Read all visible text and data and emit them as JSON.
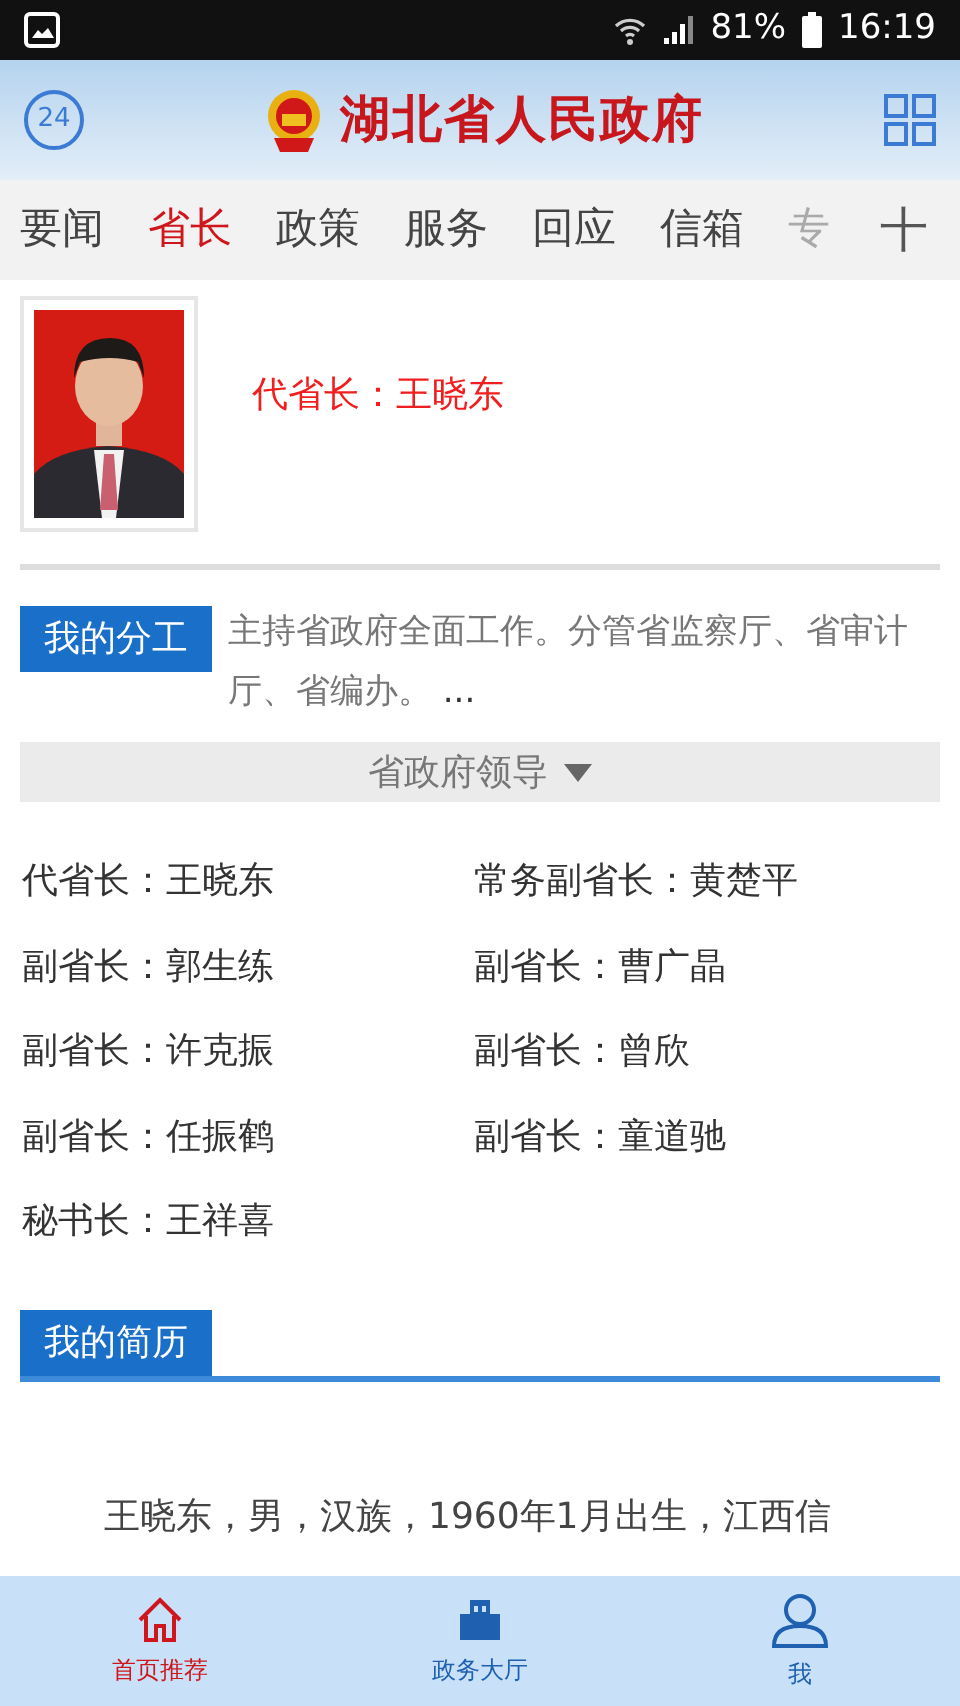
{
  "status_bar": {
    "battery": "81%",
    "time": "16:19"
  },
  "header": {
    "badge": "24",
    "title": "湖北省人民政府"
  },
  "tabs": [
    {
      "label": "要闻",
      "selected": false
    },
    {
      "label": "省长",
      "selected": true
    },
    {
      "label": "政策",
      "selected": false
    },
    {
      "label": "服务",
      "selected": false
    },
    {
      "label": "回应",
      "selected": false
    },
    {
      "label": "信箱",
      "selected": false
    },
    {
      "label": "专",
      "selected": false
    }
  ],
  "add_tab": "十",
  "profile": {
    "title": "代省长：王晓东"
  },
  "division": {
    "label": "我的分工",
    "text": "主持省政府全面工作。分管省监察厅、省审计厅、省编办。",
    "more": "..."
  },
  "leaders": {
    "heading": "省政府领导",
    "expanded": false,
    "items": [
      {
        "text": "代省长：王晓东"
      },
      {
        "text": "常务副省长：黄楚平"
      },
      {
        "text": "副省长：郭生练"
      },
      {
        "text": "副省长：曹广晶"
      },
      {
        "text": "副省长：许克振"
      },
      {
        "text": "副省长：曾欣"
      },
      {
        "text": "副省长：任振鹤"
      },
      {
        "text": "副省长：童道驰"
      },
      {
        "text": "秘书长：王祥喜"
      }
    ]
  },
  "resume": {
    "label": "我的简历",
    "text": "王晓东，男，汉族，1960年1月出生，江西信"
  },
  "bottom_nav": [
    {
      "label": "首页推荐",
      "kind": "home",
      "selected": true
    },
    {
      "label": "政务大厅",
      "kind": "hall",
      "selected": false
    },
    {
      "label": "我",
      "kind": "user",
      "selected": false
    }
  ]
}
